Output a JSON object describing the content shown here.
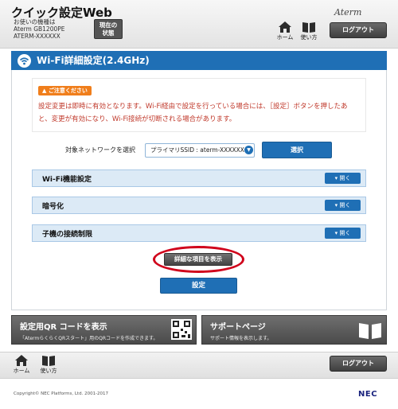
{
  "header": {
    "app_title": "クイック設定Web",
    "model_label": "お使いの機種は",
    "model_name": "Aterm GB1200PE",
    "model_id": "ATERM-XXXXXX",
    "status_button": [
      "現在の",
      "状態"
    ],
    "brand": "Aterm",
    "home_label": "ホーム",
    "help_label": "使い方",
    "logout_label": "ログアウト"
  },
  "panel": {
    "title": "Wi-Fi詳細設定(2.4GHz)",
    "notice_badge": "ご注意ください",
    "notice_text": "設定変更は即時に有効となります。Wi-Fi経由で設定を行っている場合には、［設定］ボタンを押したあと、変更が有効になり、Wi-Fi接続が切断される場合があります。",
    "network_label": "対象ネットワークを選択",
    "network_selected": "プライマリSSID : aterm-XXXXXX-g",
    "select_button": "選択",
    "sections": [
      {
        "label": "Wi-Fi機能設定",
        "toggle": "開く"
      },
      {
        "label": "暗号化",
        "toggle": "開く"
      },
      {
        "label": "子機の接続制限",
        "toggle": "開く"
      }
    ],
    "detail_button": "詳細な項目を表示",
    "apply_button": "設定"
  },
  "cards": {
    "qr": {
      "title": "設定用QR コードを表示",
      "subtitle": "「AtermらくらくQRスタート」用のQRコードを作成できます。"
    },
    "support": {
      "title": "サポートページ",
      "subtitle": "サポート情報を表示します。"
    }
  },
  "footer": {
    "home_label": "ホーム",
    "help_label": "使い方",
    "logout_label": "ログアウト",
    "copyright": "Copyright© NEC Platforms, Ltd. 2001-2017",
    "logo": "NEC"
  },
  "colors": {
    "accent": "#1f6fb5",
    "notice": "#c0392b",
    "highlight": "#d0021b"
  }
}
